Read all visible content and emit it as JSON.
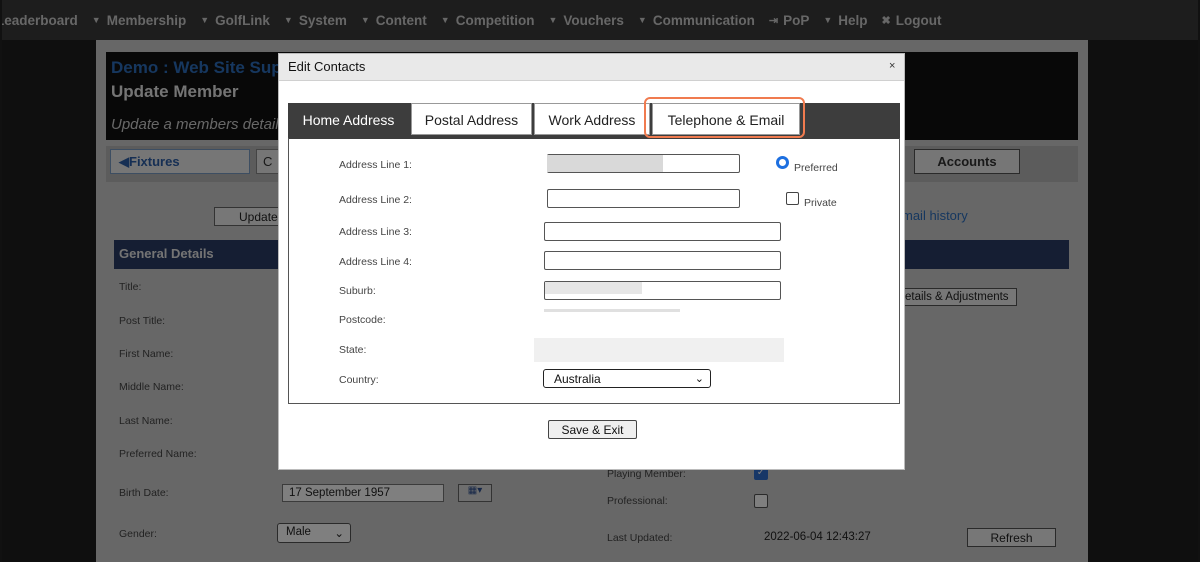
{
  "nav": {
    "items": [
      {
        "label": "Leaderboard",
        "caret": false,
        "sym": ""
      },
      {
        "label": "Membership",
        "caret": true,
        "sym": ""
      },
      {
        "label": "GolfLink",
        "caret": true,
        "sym": ""
      },
      {
        "label": "System",
        "caret": true,
        "sym": ""
      },
      {
        "label": "Content",
        "caret": true,
        "sym": ""
      },
      {
        "label": "Competition",
        "caret": true,
        "sym": ""
      },
      {
        "label": "Vouchers",
        "caret": true,
        "sym": ""
      },
      {
        "label": "Communication",
        "caret": true,
        "sym": ""
      },
      {
        "label": "PoP",
        "caret": false,
        "sym": "⇥"
      },
      {
        "label": "Help",
        "caret": true,
        "sym": ""
      },
      {
        "label": "Logout",
        "caret": false,
        "sym": "✖"
      }
    ]
  },
  "background": {
    "site_title": "Demo : Web Site Sup",
    "heading": "Update Member",
    "subtitle": "Update a members details",
    "fixtures_button": "◀Fixtures",
    "c_button": "C",
    "accounts_button": "Accounts",
    "update_button": "Update",
    "email_history": "mail history",
    "section_title": "General Details",
    "details_button": "etails & Adjustments",
    "labels": {
      "title": "Title:",
      "post_title": "Post Title:",
      "first_name": "First Name:",
      "middle_name": "Middle Name:",
      "last_name": "Last Name:",
      "preferred_name": "Preferred Name:",
      "birth_date": "Birth Date:",
      "gender": "Gender:",
      "playing_member": "Playing Member:",
      "professional": "Professional:",
      "last_updated": "Last Updated:"
    },
    "birth_date_value": "17 September 1957",
    "gender_value": "Male",
    "last_updated_value": "2022-06-04 12:43:27",
    "refresh_button": "Refresh"
  },
  "modal": {
    "title": "Edit Contacts",
    "close": "×",
    "tabs": [
      {
        "label": "Home Address",
        "active": true
      },
      {
        "label": "Postal Address",
        "active": false
      },
      {
        "label": "Work Address",
        "active": false
      },
      {
        "label": "Telephone & Email",
        "active": false
      }
    ],
    "highlight_color": "#f07b4f",
    "fields": {
      "address_line_1": "Address Line 1:",
      "address_line_2": "Address Line 2:",
      "address_line_3": "Address Line 3:",
      "address_line_4": "Address Line 4:",
      "suburb": "Suburb:",
      "postcode": "Postcode:",
      "state": "State:",
      "country": "Country:"
    },
    "preferred_label": "Preferred",
    "private_label": "Private",
    "country_value": "Australia",
    "save_button": "Save & Exit"
  }
}
